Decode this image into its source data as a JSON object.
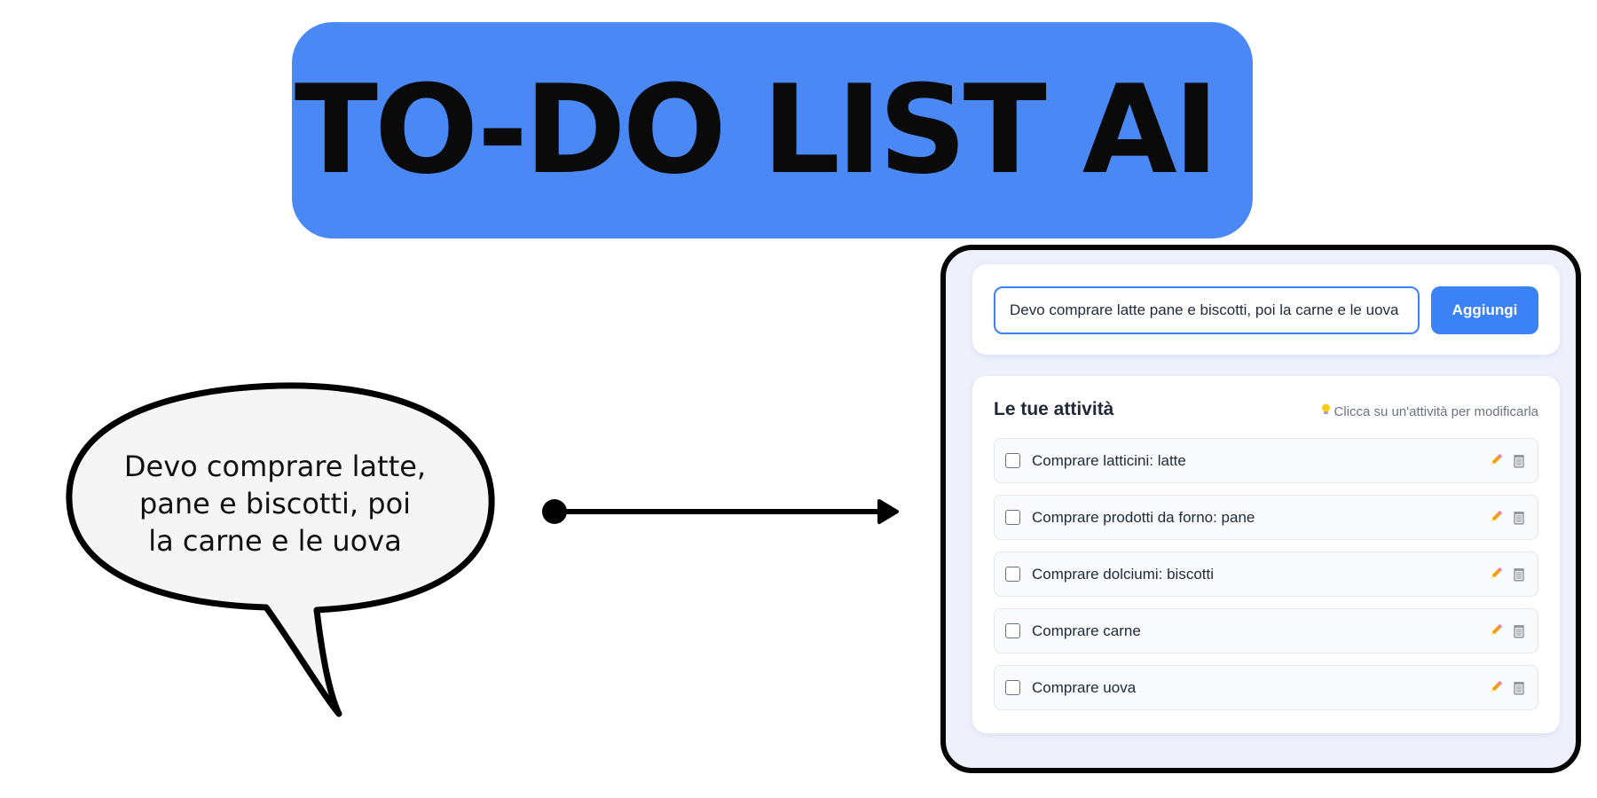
{
  "banner": {
    "title": "TO-DO LIST AI",
    "color": "#4a89f5"
  },
  "speech_bubble": {
    "lines": [
      "Devo comprare latte,",
      "pane e biscotti, poi",
      "la carne e le uova"
    ]
  },
  "app": {
    "input": {
      "value": "Devo comprare latte pane e biscotti, poi la carne e le uova"
    },
    "add_button_label": "Aggiungi",
    "list": {
      "heading": "Le tue attività",
      "hint_icon": "lightbulb-icon",
      "hint": "Clicca su un'attività per modificarla",
      "tasks": [
        {
          "label": "Comprare latticini: latte",
          "checked": false
        },
        {
          "label": "Comprare prodotti da forno: pane",
          "checked": false
        },
        {
          "label": "Comprare dolciumi: biscotti",
          "checked": false
        },
        {
          "label": "Comprare carne",
          "checked": false
        },
        {
          "label": "Comprare uova",
          "checked": false
        }
      ],
      "task_icons": [
        "pencil-icon",
        "trash-icon"
      ]
    },
    "accent_color": "#3b82f6"
  }
}
